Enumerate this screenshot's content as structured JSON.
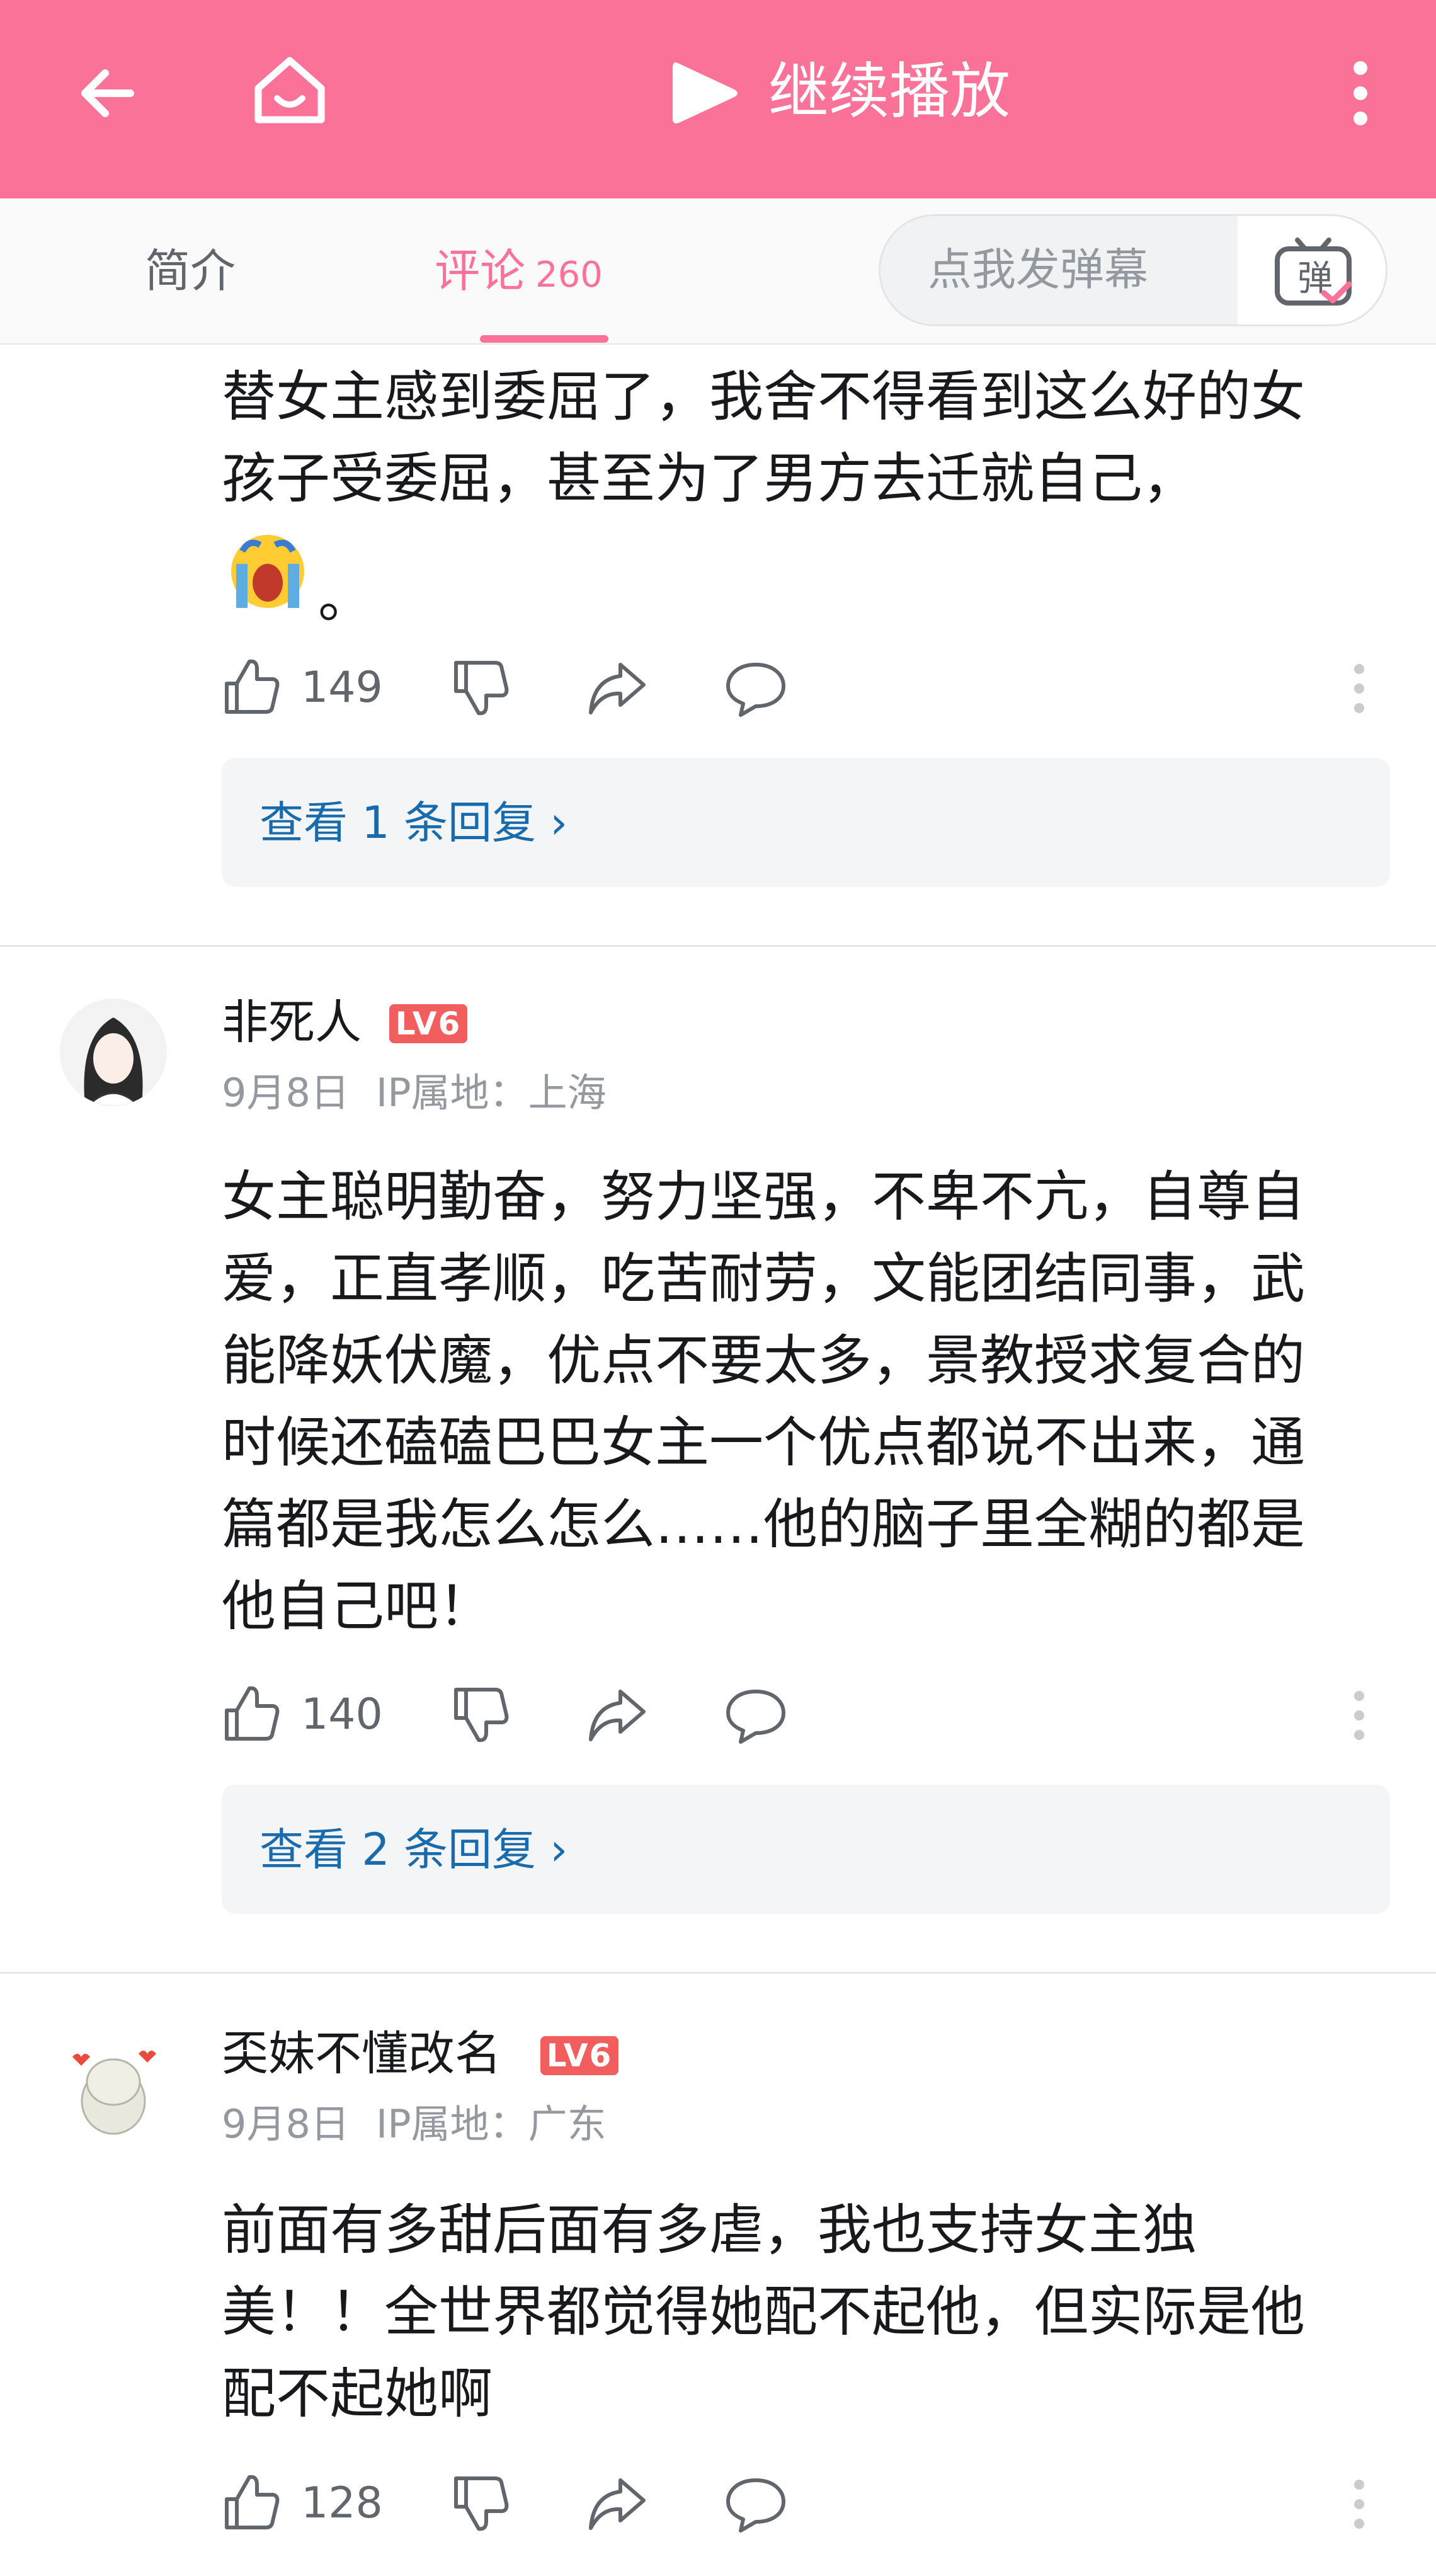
{
  "header": {
    "play_label": "继续播放",
    "icons": {
      "back": "arrow-left-icon",
      "home": "home-icon",
      "play": "play-icon",
      "more": "more-vertical-icon"
    },
    "brand_color": "#fb7299"
  },
  "tabs": [
    {
      "label": "简介",
      "count": ""
    },
    {
      "label": "评论",
      "count": "260"
    }
  ],
  "danmaku": {
    "placeholder": "点我发弹幕",
    "button_glyph": "弹"
  },
  "comments": [
    {
      "text": "替女主感到委屈了，我舍不得看到这么好的女\n孩子受委屈，甚至为了男方去迁就自己，\n",
      "emoji_tail": "。",
      "likes": "149",
      "reply_link": "查看 1 条回复 ›"
    },
    {
      "username": "非死人",
      "level": "LV6",
      "date": "9月8日",
      "ip": "IP属地：上海",
      "text": "女主聪明勤奋，努力坚强，不卑不亢，自尊自\n爱，正直孝顺，吃苦耐劳，文能团结同事，武\n能降妖伏魔，优点不要太多，景教授求复合的\n时候还磕磕巴巴女主一个优点都说不出来，通\n篇都是我怎么怎么……他的脑子里全糊的都是\n他自己吧！",
      "likes": "140",
      "reply_link": "查看 2 条回复 ›"
    },
    {
      "username": "奀妹不懂改名",
      "level": "LV6",
      "date": "9月8日",
      "ip": "IP属地：广东",
      "text": "前面有多甜后面有多虐，我也支持女主独\n美！！全世界都觉得她配不起他，但实际是他\n配不起她啊",
      "likes": "128"
    }
  ]
}
